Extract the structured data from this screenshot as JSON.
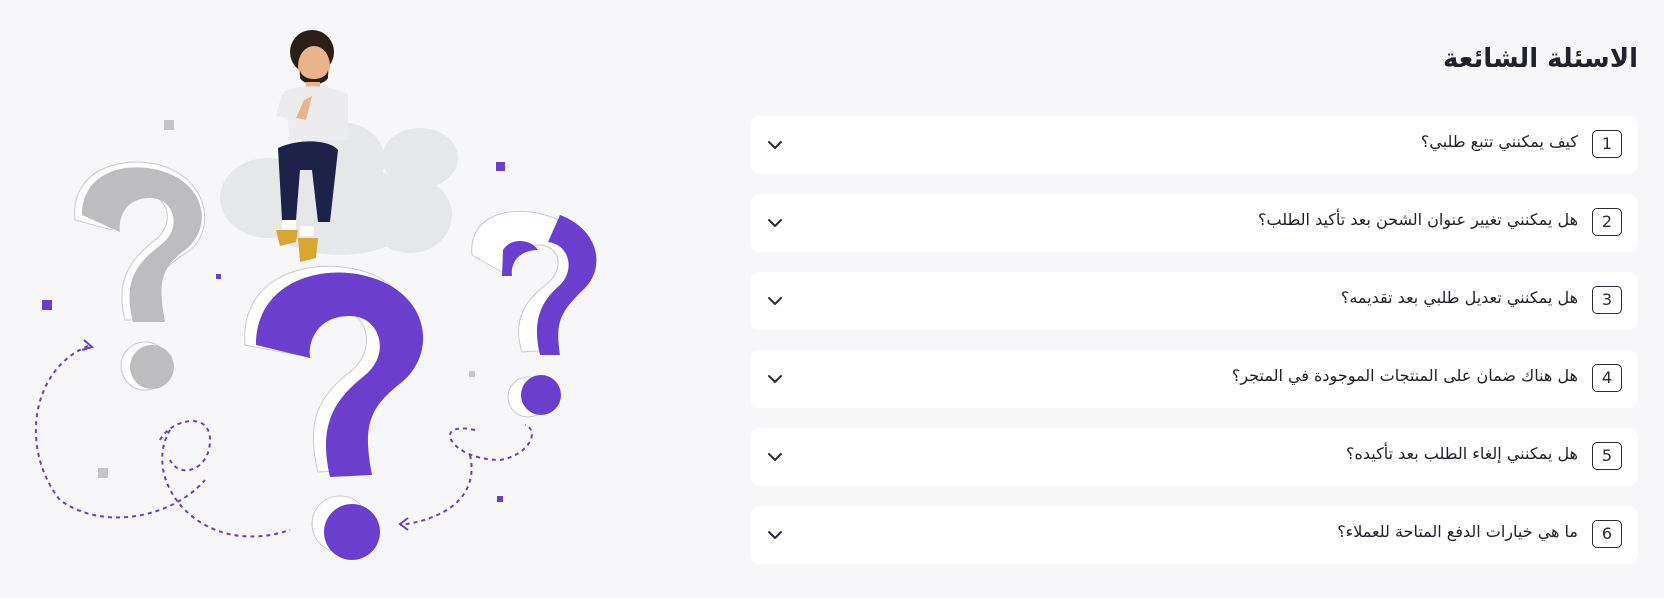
{
  "faq": {
    "title": "الاسئلة الشائعة",
    "items": [
      {
        "number": "1",
        "question": "كيف يمكنني تتبع طلبي؟"
      },
      {
        "number": "2",
        "question": "هل يمكنني تغيير عنوان الشحن بعد تأكيد الطلب؟"
      },
      {
        "number": "3",
        "question": "هل يمكنني تعديل طلبي بعد تقديمه؟"
      },
      {
        "number": "4",
        "question": "هل هناك ضمان على المنتجات الموجودة في المتجر؟"
      },
      {
        "number": "5",
        "question": "هل يمكنني إلغاء الطلب بعد تأكيده؟"
      },
      {
        "number": "6",
        "question": "ما هي خيارات الدفع المتاحة للعملاء؟"
      }
    ]
  },
  "icons": {
    "toggle": "chevron-down-icon"
  },
  "colors": {
    "accent": "#6a3fce",
    "question_mark_gray": "#bdbdbf",
    "background": "#f7f7fa",
    "card": "#ffffff"
  }
}
